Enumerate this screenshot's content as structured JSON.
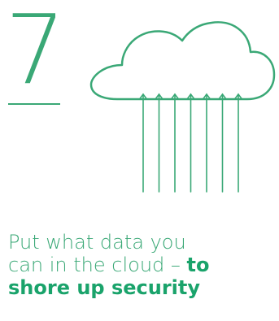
{
  "step": {
    "number": "7"
  },
  "caption": {
    "line1": "Put what data you",
    "line2_plain": "can in the cloud – ",
    "line2_emphasis": "to",
    "line3_emphasis": "shore up security"
  },
  "icon": {
    "name": "cloud-upload-arrows-icon",
    "arrow_count": 7
  },
  "colors": {
    "accent": "#3aa876",
    "emphasis": "#1aa36b",
    "background": "#ffffff"
  }
}
